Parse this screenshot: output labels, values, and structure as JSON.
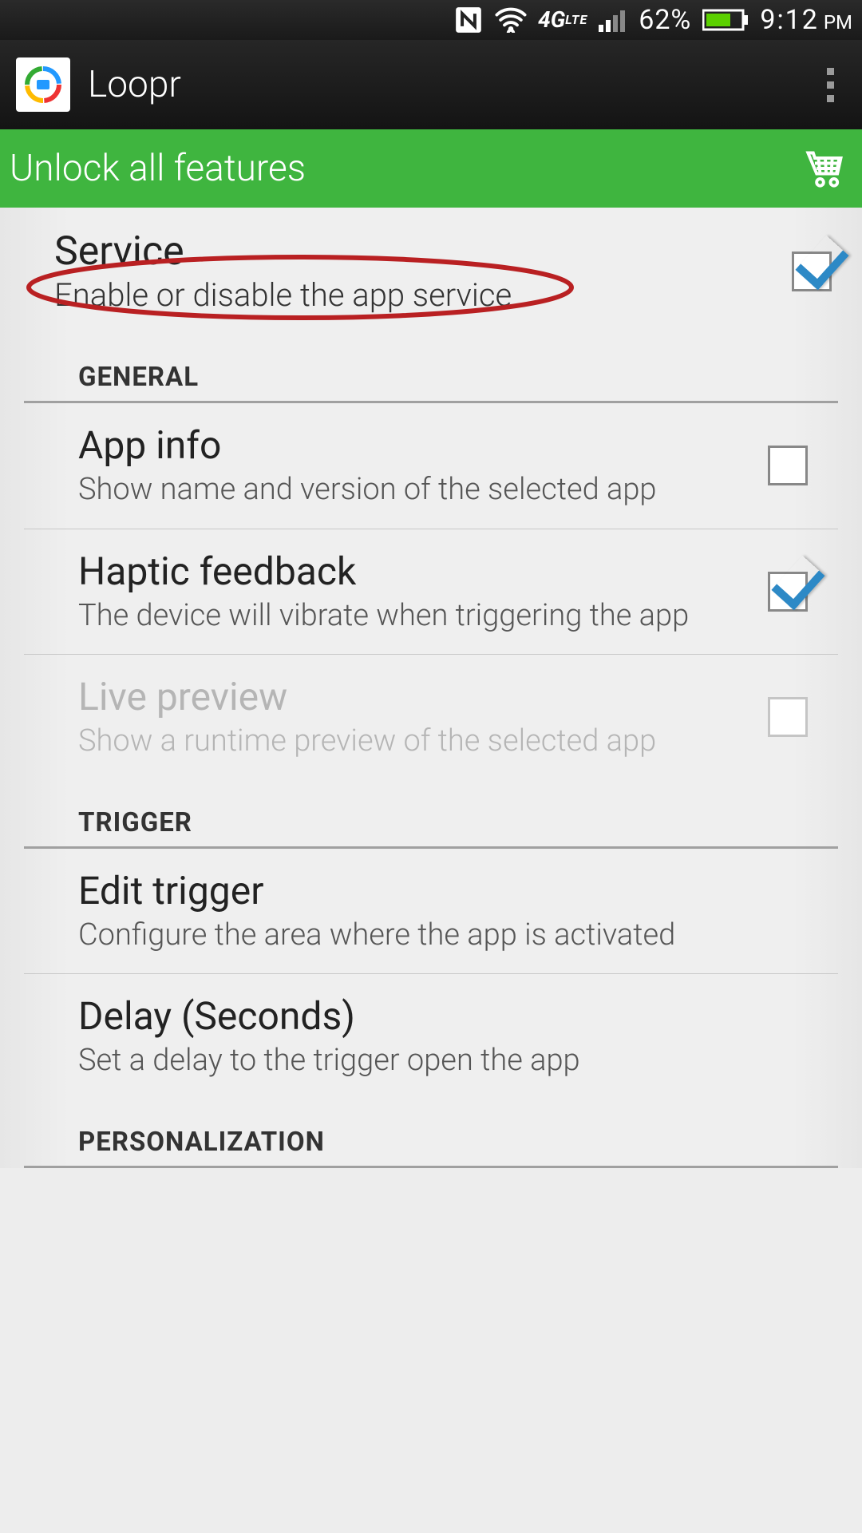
{
  "status": {
    "battery_pct": "62%",
    "clock": "9:12",
    "ampm": "PM",
    "net_label": "4G LTE"
  },
  "app": {
    "title": "Loopr"
  },
  "unlock": {
    "label": "Unlock all features"
  },
  "service": {
    "title": "Service",
    "subtitle": "Enable or disable the app service",
    "checked": true
  },
  "sections": {
    "general": "GENERAL",
    "trigger": "TRIGGER",
    "personalization": "PERSONALIZATION"
  },
  "prefs": {
    "app_info": {
      "title": "App info",
      "subtitle": "Show name and version of the selected app",
      "checked": false
    },
    "haptic": {
      "title": "Haptic feedback",
      "subtitle": "The device will vibrate when triggering the app",
      "checked": true
    },
    "live_preview": {
      "title": "Live preview",
      "subtitle": "Show a runtime preview of the selected app",
      "checked": false,
      "disabled": true
    },
    "edit_trigger": {
      "title": "Edit trigger",
      "subtitle": "Configure the area where the app is activated"
    },
    "delay": {
      "title": "Delay (Seconds)",
      "subtitle": "Set a delay to the trigger open the app"
    }
  },
  "annotation": {
    "circled": "service.subtitle",
    "color": "#b92022"
  }
}
